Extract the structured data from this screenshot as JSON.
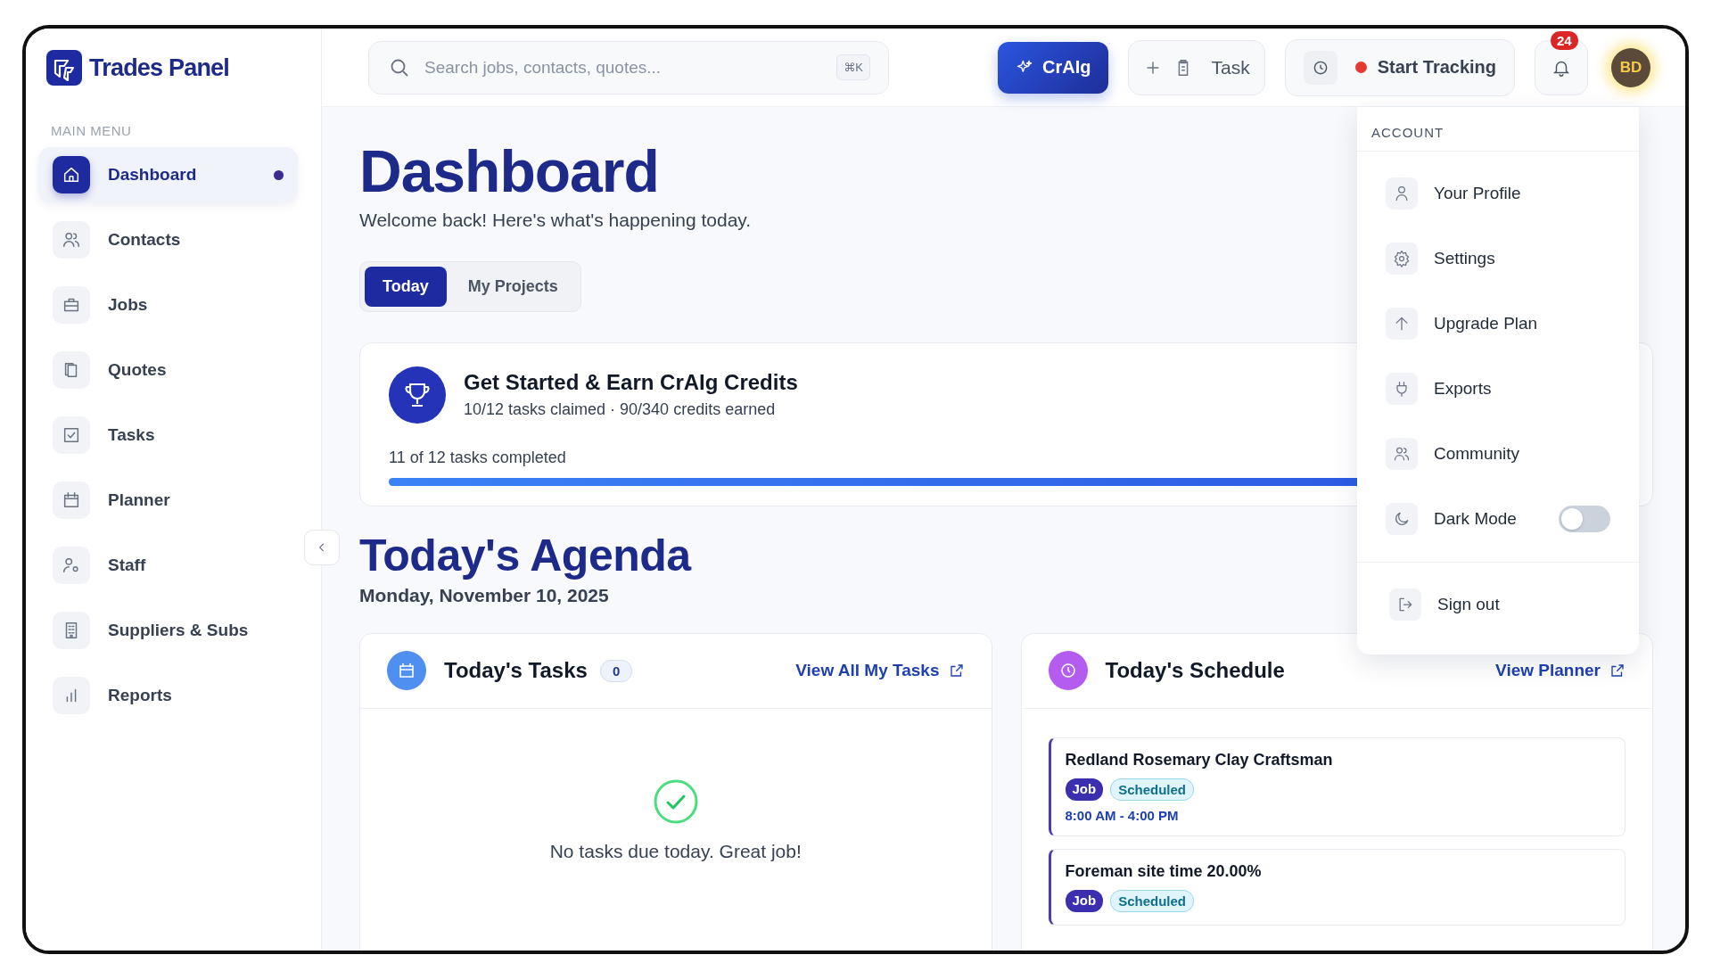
{
  "brand": {
    "name": "Trades Panel"
  },
  "search": {
    "placeholder": "Search jobs, contacts, quotes...",
    "shortcut": "⌘K"
  },
  "topbar": {
    "assistant_button": "CrAIg",
    "task_button": "Task",
    "tracking_button": "Start Tracking",
    "notification_count": "24",
    "avatar_initials": "BD"
  },
  "sidebar": {
    "heading": "MAIN MENU",
    "items": [
      {
        "label": "Dashboard",
        "selected": true
      },
      {
        "label": "Contacts",
        "selected": false
      },
      {
        "label": "Jobs",
        "selected": false
      },
      {
        "label": "Quotes",
        "selected": false
      },
      {
        "label": "Tasks",
        "selected": false
      },
      {
        "label": "Planner",
        "selected": false
      },
      {
        "label": "Staff",
        "selected": false
      },
      {
        "label": "Suppliers & Subs",
        "selected": false
      },
      {
        "label": "Reports",
        "selected": false
      }
    ]
  },
  "page": {
    "title": "Dashboard",
    "subtitle": "Welcome back! Here's what's happening today."
  },
  "tabs": [
    {
      "label": "Today",
      "selected": true
    },
    {
      "label": "My Projects",
      "selected": false
    }
  ],
  "credits_card": {
    "title": "Get Started & Earn CrAIg Credits",
    "subtitle": "10/12 tasks claimed · 90/340 credits earned",
    "progress_label": "11 of 12 tasks completed",
    "level": 0.92
  },
  "agenda": {
    "title": "Today's Agenda",
    "date": "Monday, November 10, 2025"
  },
  "tasks_panel": {
    "title": "Today's Tasks",
    "count": "0",
    "link": "View All My Tasks",
    "empty_message": "No tasks due today. Great job!"
  },
  "schedule_panel": {
    "title": "Today's Schedule",
    "link": "View Planner",
    "items": [
      {
        "title": "Redland Rosemary Clay Craftsman",
        "tags": [
          {
            "label": "Job",
            "kind": "type"
          },
          {
            "label": "Scheduled",
            "kind": "status"
          }
        ],
        "time": "8:00 AM - 4:00 PM"
      },
      {
        "title": "Foreman site time 20.00%",
        "tags": [
          {
            "label": "Job",
            "kind": "type"
          },
          {
            "label": "Scheduled",
            "kind": "status"
          }
        ]
      }
    ]
  },
  "account_menu": {
    "heading": "ACCOUNT",
    "items": [
      {
        "label": "Your Profile",
        "kind": "link"
      },
      {
        "label": "Settings",
        "kind": "link"
      },
      {
        "label": "Upgrade Plan",
        "kind": "link"
      },
      {
        "label": "Exports",
        "kind": "link"
      },
      {
        "label": "Community",
        "kind": "link"
      },
      {
        "label": "Dark Mode",
        "kind": "toggle",
        "on": false
      }
    ],
    "sign_out": "Sign out"
  }
}
